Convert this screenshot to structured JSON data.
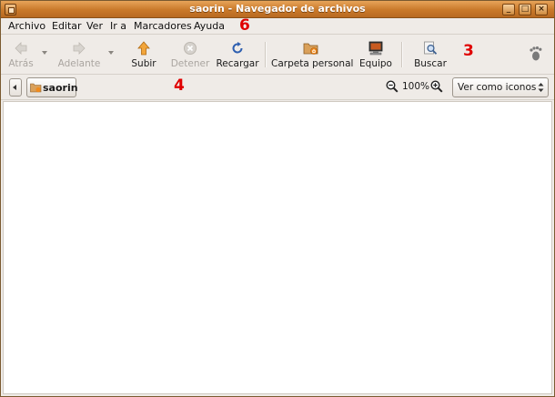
{
  "window": {
    "title": "saorin - Navegador de archivos",
    "controls": {
      "minimize": "_",
      "maximize": "□",
      "close": "×"
    }
  },
  "menubar": {
    "items": [
      "Archivo",
      "Editar",
      "Ver",
      "Ir a",
      "Marcadores",
      "Ayuda"
    ]
  },
  "toolbar": {
    "back": "Atrás",
    "forward": "Adelante",
    "up": "Subir",
    "stop": "Detener",
    "reload": "Recargar",
    "home": "Carpeta personal",
    "computer": "Equipo",
    "search": "Buscar"
  },
  "location": {
    "crumb": "saorin",
    "zoom": "100%",
    "view_mode": "Ver como iconos"
  },
  "annotations": {
    "menubar_marker": "6",
    "toolbar_marker": "3",
    "locbar_marker": "4"
  },
  "colors": {
    "titlebar": "#c9792a",
    "annotation": "#e00000"
  }
}
